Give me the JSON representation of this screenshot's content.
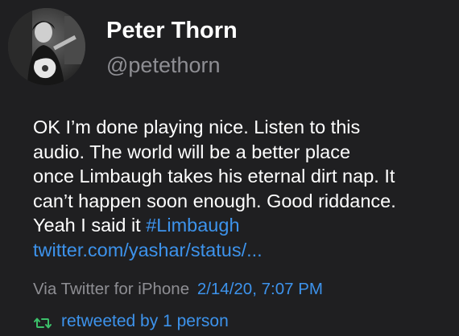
{
  "user": {
    "display_name": "Peter Thorn",
    "handle": "@petethorn",
    "avatar_icon": "profile-photo-guitarist"
  },
  "tweet": {
    "lines": [
      "OK I’m done playing nice. Listen to this",
      "audio. The world will be a better place",
      "once Limbaugh takes his eternal dirt nap. It",
      "can’t happen soon enough. Good riddance."
    ],
    "last_line_text": "Yeah I said it ",
    "hashtag": "#Limbaugh",
    "link": "twitter.com/yashar/status/..."
  },
  "meta": {
    "source": "Via Twitter for iPhone",
    "timestamp": "2/14/20, 7:07 PM"
  },
  "retweet": {
    "icon": "retweet-icon",
    "label": "retweeted by 1 person"
  },
  "colors": {
    "background": "#1f1f21",
    "link": "#3d93ec",
    "secondary_text": "#8e8e93",
    "retweet_green": "#3cc06a"
  }
}
